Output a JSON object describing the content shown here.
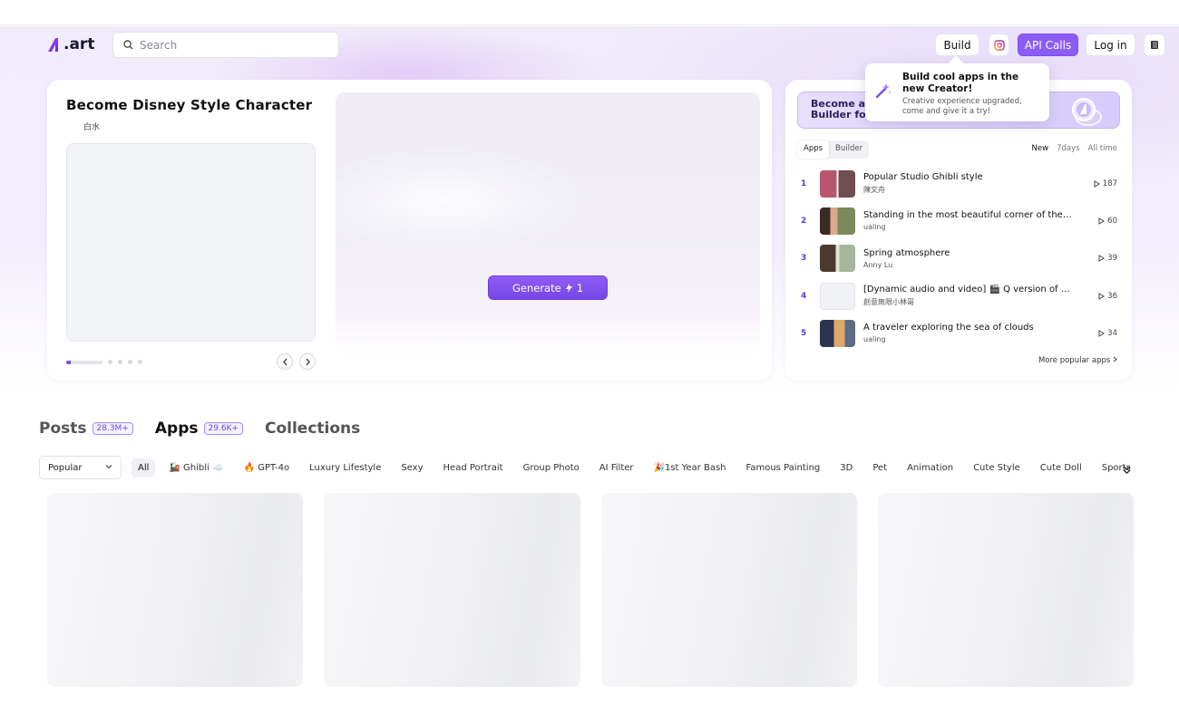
{
  "nav": {
    "logo_text": ".art",
    "search_placeholder": "Search",
    "build_label": "Build",
    "api_label": "API Calls",
    "login_label": "Log in"
  },
  "tooltip": {
    "title": "Build cool apps in the new Creator!",
    "body": "Creative experience upgraded, come and give it a try!"
  },
  "featured": {
    "title": "Become Disney Style Character",
    "author": "白水",
    "generate_label": "Generate",
    "generate_cost": "1"
  },
  "sidebar": {
    "banner_text": "Become an\nBuilder for",
    "tabs": [
      "Apps",
      "Builder"
    ],
    "periods": [
      "New",
      "7days",
      "All time"
    ],
    "ranking": [
      {
        "rank": "1",
        "name": "Popular Studio Ghibli style",
        "author": "陳文舟",
        "plays": "187",
        "thumb": "#a86f7d"
      },
      {
        "rank": "2",
        "name": "Standing in the most beautiful corner of the w...",
        "author": "ualing",
        "plays": "60",
        "thumb": "#9c6a4e"
      },
      {
        "rank": "3",
        "name": "Spring atmosphere",
        "author": "Anny Lu",
        "plays": "39",
        "thumb": "#8d8a7c"
      },
      {
        "rank": "4",
        "name": "[Dynamic audio and video] 🎬 Q version of cut...",
        "author": "創意無限小林哥",
        "plays": "36",
        "thumb": "#f1f2f5"
      },
      {
        "rank": "5",
        "name": "A traveler exploring the sea of clouds",
        "author": "ualing",
        "plays": "34",
        "thumb": "#c48f57"
      }
    ],
    "more_label": "More popular apps"
  },
  "sections": {
    "posts": {
      "label": "Posts",
      "count": "28.3M+"
    },
    "apps": {
      "label": "Apps",
      "count": "29.6K+"
    },
    "collections": {
      "label": "Collections"
    }
  },
  "filter": {
    "sort_value": "Popular",
    "categories": [
      "All",
      "🚂 Ghibli ☁️",
      "🔥 GPT-4o",
      "Luxury Lifestyle",
      "Sexy",
      "Head Portrait",
      "Group Photo",
      "AI Filter",
      "🎉1st Year Bash",
      "Famous Painting",
      "3D",
      "Pet",
      "Animation",
      "Cute Style",
      "Cute Doll",
      "Sports"
    ]
  },
  "colors": {
    "accent": "#8b5cf6",
    "rank_number": "#5b3fd6"
  }
}
